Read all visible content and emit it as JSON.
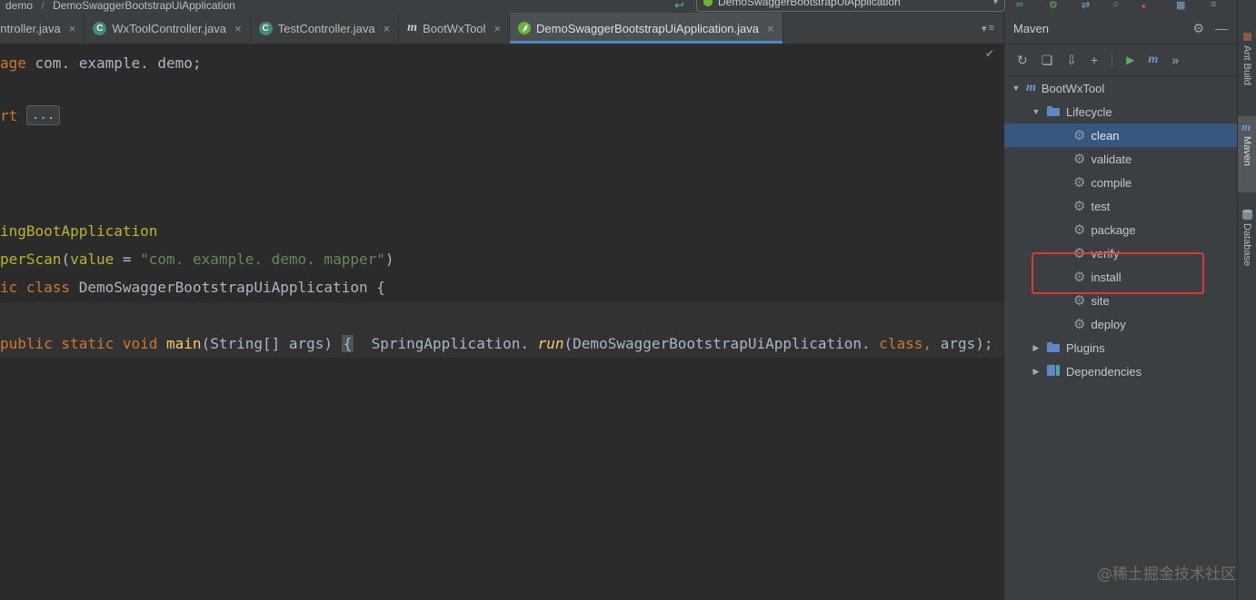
{
  "topbar": {
    "breadcrumb": [
      "demo",
      "DemoSwaggerBootstrapUiApplication"
    ],
    "separator": "/",
    "run_config": "DemoSwaggerBootstrapUiApplication"
  },
  "tabs": [
    {
      "label": "ontroller.java"
    },
    {
      "label": "WxToolController.java"
    },
    {
      "label": "TestController.java"
    },
    {
      "label": "BootWxTool"
    },
    {
      "label": "DemoSwaggerBootstrapUiApplication.java"
    }
  ],
  "editor": {
    "lines": [
      [
        "age",
        " com. example. demo;"
      ],
      [
        "rt ",
        "..."
      ],
      [
        "ingBootApplication"
      ],
      [
        "perScan",
        "(",
        "value ",
        "= ",
        "\"com. example. demo. mapper\"",
        ")"
      ],
      [
        "ic class ",
        "DemoSwaggerBootstrapUiApplication ",
        "{"
      ],
      [
        "public static void ",
        "main",
        "(String[] args) ",
        "{",
        "  ",
        "SpringApplication. ",
        "run",
        "(DemoSwaggerBootstrapUiApplication. ",
        "class",
        ", ",
        "args)",
        ";"
      ]
    ]
  },
  "maven": {
    "title": "Maven",
    "project": "BootWxTool",
    "lifecycle": "Lifecycle",
    "goals": [
      "clean",
      "validate",
      "compile",
      "test",
      "package",
      "verify",
      "install",
      "site",
      "deploy"
    ],
    "selected_goal": "clean",
    "annotated_goal": "install",
    "nodes": [
      "Plugins",
      "Dependencies"
    ]
  },
  "right_sidebar": [
    "Ant Build",
    "Maven",
    "Database"
  ],
  "watermark": "@稀土掘金技术社区",
  "icons": {
    "close": "×",
    "refresh": "↻",
    "sources": "❏",
    "download": "⇩",
    "add": "+",
    "run": "▶",
    "maven_m": "m",
    "more": "»",
    "gear": "⚙",
    "minimize": "—",
    "tri_down": "▼",
    "tri_right": "▶",
    "chevron_down": "▾",
    "tabs_list": "≡",
    "check": "✔",
    "back": "↩",
    "swap": "⇄",
    "circle": "○",
    "square": "▪",
    "grid": "▦",
    "list": "≡",
    "infinity": "∞"
  },
  "colors": {
    "accent": "#4a88c7",
    "selection": "#365880",
    "annotation_red": "#dc3a33",
    "keyword": "#cc7832",
    "string": "#6a8759",
    "annotation": "#bbb529",
    "method": "#ffc66b",
    "plain": "#a9b7c6"
  }
}
